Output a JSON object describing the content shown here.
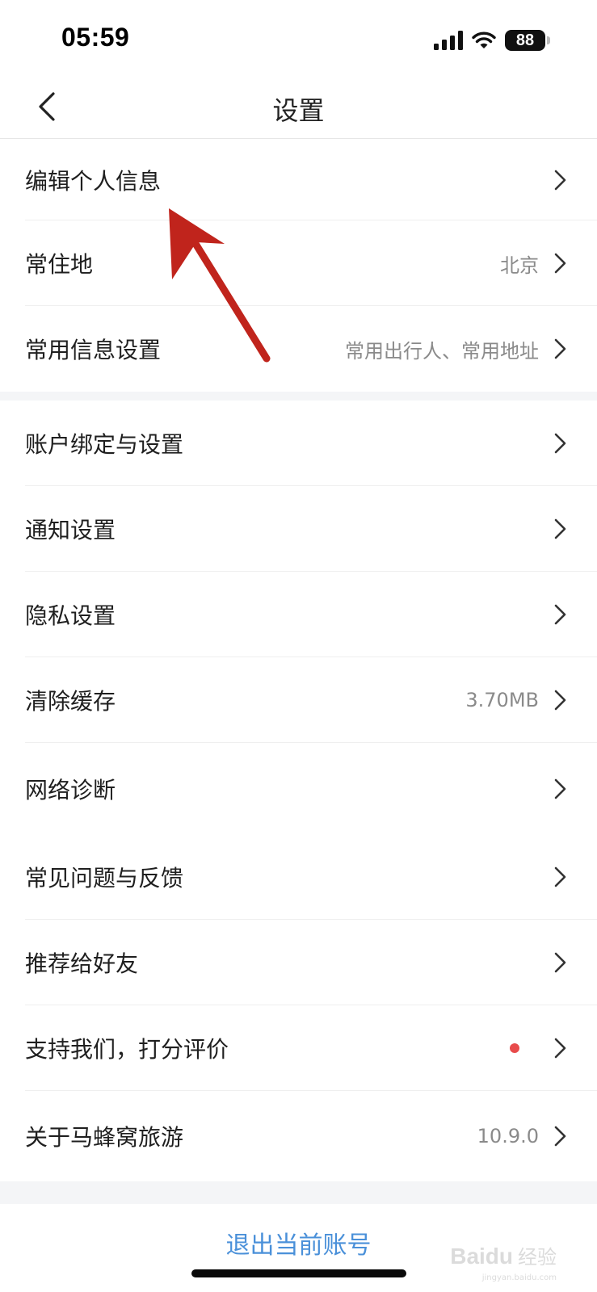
{
  "status_bar": {
    "time": "05:59",
    "battery": "88"
  },
  "nav": {
    "title": "设置"
  },
  "groups": [
    {
      "items": [
        {
          "label": "编辑个人信息",
          "value": ""
        },
        {
          "label": "常住地",
          "value": "北京"
        },
        {
          "label": "常用信息设置",
          "value": "常用出行人、常用地址"
        }
      ]
    },
    {
      "items": [
        {
          "label": "账户绑定与设置",
          "value": ""
        },
        {
          "label": "通知设置",
          "value": ""
        },
        {
          "label": "隐私设置",
          "value": ""
        },
        {
          "label": "清除缓存",
          "value": "3.70MB"
        },
        {
          "label": "网络诊断",
          "value": ""
        }
      ]
    },
    {
      "items": [
        {
          "label": "常见问题与反馈",
          "value": ""
        },
        {
          "label": "推荐给好友",
          "value": ""
        },
        {
          "label": "支持我们，打分评价",
          "value": ""
        },
        {
          "label": "关于马蜂窝旅游",
          "value": "10.9.0"
        }
      ]
    }
  ],
  "logout": {
    "label": "退出当前账号"
  },
  "watermark": {
    "logo": "Baidu",
    "cn": "经验",
    "sub": "jingyan.baidu.com"
  },
  "colors": {
    "accent_link": "#4a90d9",
    "badge_dot": "#e84b4b",
    "annotation_arrow": "#c0241c"
  }
}
